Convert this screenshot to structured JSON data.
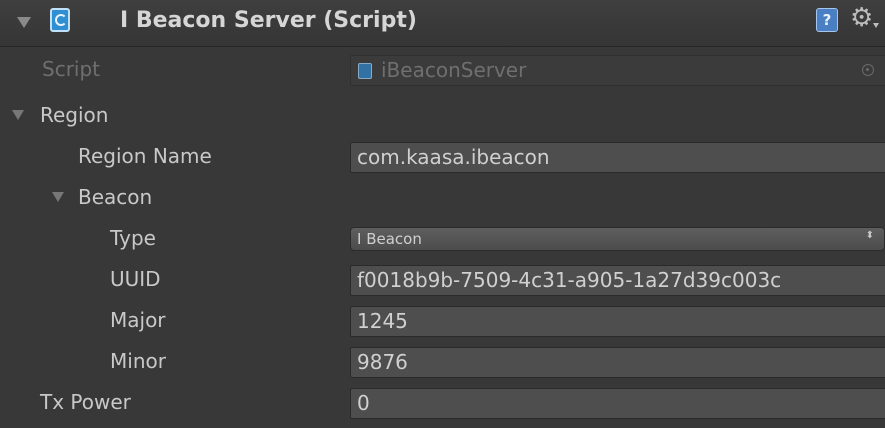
{
  "header": {
    "title": "I Beacon Server (Script)",
    "help_glyph": "?",
    "gear_glyph": "⚙"
  },
  "script": {
    "label": "Script",
    "value": "iBeaconServer"
  },
  "region": {
    "label": "Region",
    "region_name": {
      "label": "Region Name",
      "value": "com.kaasa.ibeacon"
    },
    "beacon": {
      "label": "Beacon",
      "type": {
        "label": "Type",
        "value": "I Beacon",
        "caret": "⬍"
      },
      "uuid": {
        "label": "UUID",
        "value": "f0018b9b-7509-4c31-a905-1a27d39c003c"
      },
      "major": {
        "label": "Major",
        "value": "1245"
      },
      "minor": {
        "label": "Minor",
        "value": "9876"
      }
    }
  },
  "tx_power": {
    "label": "Tx Power",
    "value": "0"
  },
  "colors": {
    "panel_bg": "#383838",
    "field_bg": "#4e4e4e",
    "text": "#c8c8c8",
    "disabled_text": "#6f6f6f",
    "script_icon": "#2f8fd2"
  }
}
